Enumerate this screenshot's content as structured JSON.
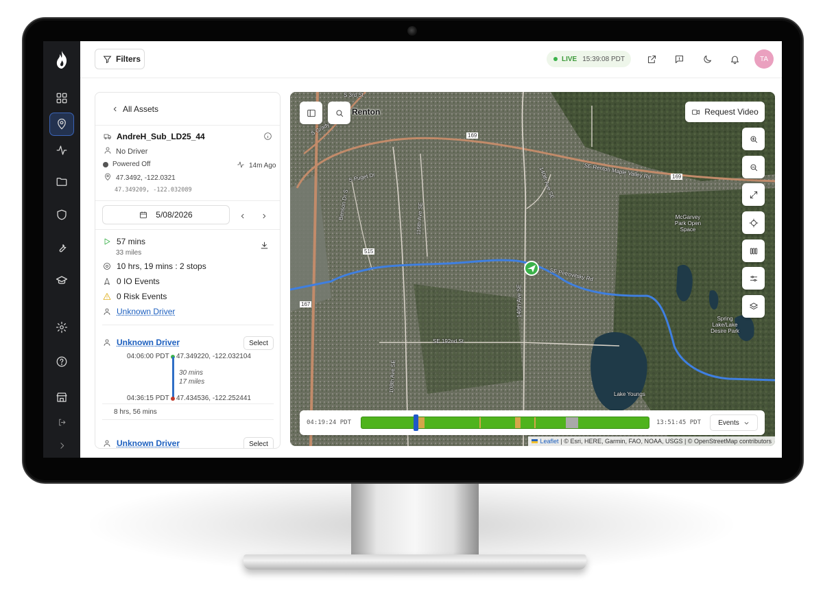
{
  "header": {
    "filters_label": "Filters",
    "live_label": "LIVE",
    "live_time": "15:39:08 PDT",
    "avatar_initials": "TA"
  },
  "panel": {
    "back_label": "All Assets",
    "asset_name": "AndreH_Sub_LD25_44",
    "driver": "No Driver",
    "power_status": "Powered Off",
    "last_seen": "14m Ago",
    "coords": "47.3492, -122.0321",
    "coords_precise": "47.349209, -122.032089",
    "date": "5/08/2026",
    "summary": {
      "drive_time": "57 mins",
      "distance": "33 miles",
      "stops": "10 hrs, 19 mins : 2 stops",
      "io_events": "0 IO Events",
      "risk_events": "0 Risk Events",
      "driver_link": "Unknown Driver"
    },
    "trips": [
      {
        "driver": "Unknown Driver",
        "select_label": "Select",
        "start_time": "04:06:00 PDT",
        "start_coords": "47.349220, -122.032104",
        "duration": "30 mins",
        "distance": "17 miles",
        "end_time": "04:36:15 PDT",
        "end_coords": "47.434536, -122.252441",
        "stop_duration": "8 hrs, 56 mins"
      },
      {
        "driver": "Unknown Driver",
        "select_label": "Select"
      }
    ]
  },
  "map": {
    "request_video_label": "Request Video",
    "labels": {
      "city": "Renton",
      "s3rd": "S 3rd St",
      "maple_valley": "SE Renton Maple Valley Rd",
      "mcgarvey": "McGarvey Park Open Space",
      "spring_lake": "Spring Lake/Lake Desire Park",
      "lake_youngs": "Lake Youngs",
      "se192": "SE 192nd St",
      "ave140": "140th Ave SE",
      "ave140n": "140th Ave SE",
      "ave108": "108th Ave SE",
      "ave116": "116th Ave SE",
      "benson": "Benson Dr S",
      "puget": "S Puget Dr",
      "sgrady": "S Grady Way",
      "hwy169": "169",
      "hwy169b": "169",
      "hwy515": "515",
      "hwy167": "167",
      "petrovitsky": "SE Petrovitsky Rd"
    },
    "timeline": {
      "start": "04:19:24 PDT",
      "end": "13:51:45 PDT",
      "events_label": "Events"
    },
    "attribution": {
      "leaflet": "Leaflet",
      "credits": "| © Esri, HERE, Garmin, FAO, NOAA, USGS | © OpenStreetMap contributors"
    }
  },
  "colors": {
    "route": "#3f7fe0",
    "accent": "#1c5fbf",
    "timeline_green": "#4fb31d",
    "live_green": "#3bb24a"
  }
}
